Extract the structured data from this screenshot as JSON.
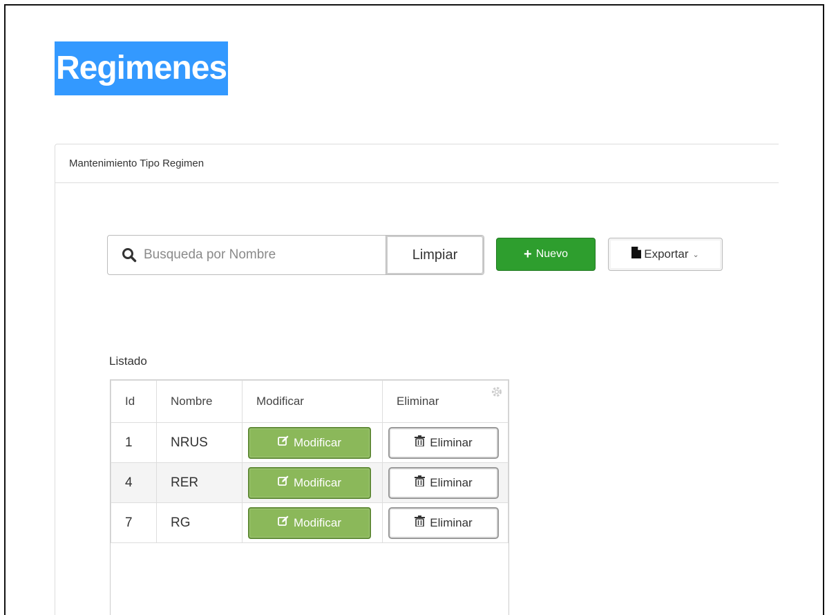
{
  "page": {
    "title": "Regimenes"
  },
  "panel": {
    "header": "Mantenimiento Tipo Regimen"
  },
  "search": {
    "placeholder": "Busqueda por Nombre",
    "value": "",
    "clear_label": "Limpiar"
  },
  "toolbar": {
    "new_label": "Nuevo",
    "export_label": "Exportar"
  },
  "list": {
    "label": "Listado",
    "columns": [
      "Id",
      "Nombre",
      "Modificar",
      "Eliminar"
    ],
    "rows": [
      {
        "id": "1",
        "name": "NRUS",
        "modify_label": "Modificar",
        "delete_label": "Eliminar"
      },
      {
        "id": "4",
        "name": "RER",
        "modify_label": "Modificar",
        "delete_label": "Eliminar"
      },
      {
        "id": "7",
        "name": "RG",
        "modify_label": "Modificar",
        "delete_label": "Eliminar"
      }
    ]
  },
  "colors": {
    "title_highlight": "#3399ff",
    "new_button": "#2e9e2e",
    "modify_button": "#8bb85a"
  },
  "icons": [
    "search-icon",
    "plus-icon",
    "file-icon",
    "chevron-down-icon",
    "gear-icon",
    "edit-icon",
    "trash-icon"
  ]
}
